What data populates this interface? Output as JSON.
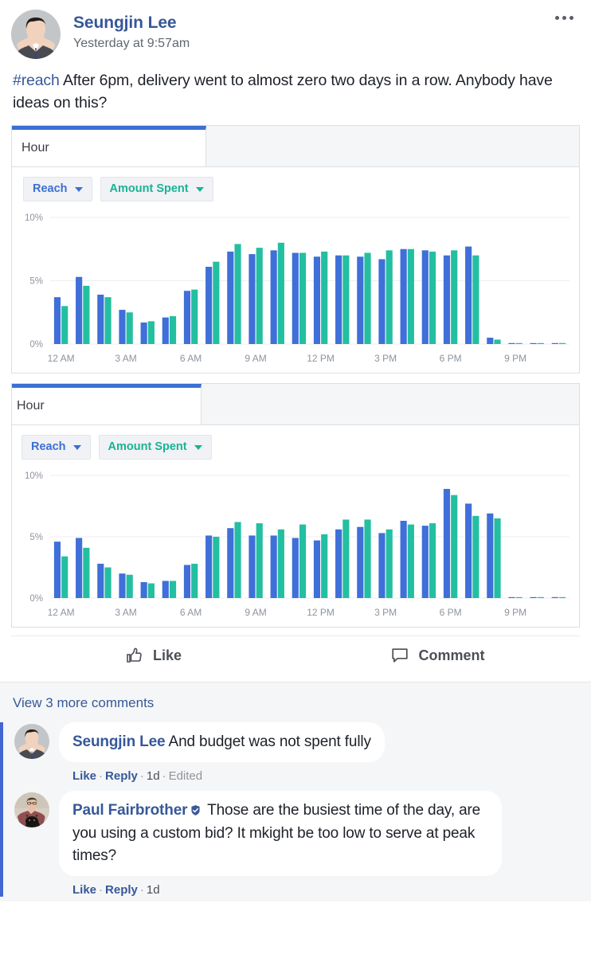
{
  "post": {
    "author": "Seungjin Lee",
    "timestamp": "Yesterday at 9:57am",
    "hashtag": "#reach",
    "body": "After 6pm, delivery went to almost zero two days in a row. Anybody have ideas on this?",
    "more_menu_icon": "ellipsis-icon"
  },
  "charts": [
    {
      "tab_label": "Hour",
      "metric_primary": "Reach",
      "metric_secondary": "Amount Spent"
    },
    {
      "tab_label": "Hour",
      "metric_primary": "Reach",
      "metric_secondary": "Amount Spent"
    }
  ],
  "actions": {
    "like_label": "Like",
    "like_icon": "thumbs-up-icon",
    "comment_label": "Comment",
    "comment_icon": "speech-bubble-icon"
  },
  "comments_section": {
    "view_more_label": "View 3 more comments",
    "comments": [
      {
        "author": "Seungjin Lee",
        "text": "And budget was not spent fully",
        "verified": false,
        "like_label": "Like",
        "reply_label": "Reply",
        "age": "1d",
        "edited_label": "Edited"
      },
      {
        "author": "Paul Fairbrother",
        "text": "Those are the busiest time of the day, are you using a custom bid? It mkight be too low to serve at peak times?",
        "verified": true,
        "badge_icon": "shield-badge-icon",
        "like_label": "Like",
        "reply_label": "Reply",
        "age": "1d",
        "edited_label": ""
      }
    ]
  },
  "colors": {
    "reach_blue": "#3f6fd8",
    "spent_teal": "#23bfa0",
    "link_blue": "#365899",
    "accent_rail": "#4267d4"
  },
  "chart_data": [
    {
      "type": "bar",
      "title": "",
      "xlabel": "Hour",
      "ylabel": "",
      "ylim": [
        0,
        10
      ],
      "ytick_labels": [
        "0%",
        "5%",
        "10%"
      ],
      "ytick_values": [
        0,
        5,
        10
      ],
      "grid": true,
      "legend_position": "top-left",
      "categories": [
        "12 AM",
        "1 AM",
        "2 AM",
        "3 AM",
        "4 AM",
        "5 AM",
        "6 AM",
        "7 AM",
        "8 AM",
        "9 AM",
        "10 AM",
        "11 AM",
        "12 PM",
        "1 PM",
        "2 PM",
        "3 PM",
        "4 PM",
        "5 PM",
        "6 PM",
        "7 PM",
        "8 PM",
        "9 PM",
        "10 PM",
        "11 PM"
      ],
      "xtick_labels": [
        "12 AM",
        "3 AM",
        "6 AM",
        "9 AM",
        "12 PM",
        "3 PM",
        "6 PM",
        "9 PM"
      ],
      "series": [
        {
          "name": "Reach",
          "color": "#3f6fd8",
          "values": [
            3.7,
            5.3,
            3.9,
            2.7,
            1.7,
            2.1,
            4.2,
            6.1,
            7.3,
            7.1,
            7.4,
            7.2,
            6.9,
            7.0,
            6.9,
            6.7,
            7.5,
            7.4,
            7.0,
            7.7,
            0.5,
            0.05,
            0.05,
            0.05
          ]
        },
        {
          "name": "Amount Spent",
          "color": "#23bfa0",
          "values": [
            3.0,
            4.6,
            3.7,
            2.5,
            1.8,
            2.2,
            4.3,
            6.5,
            7.9,
            7.6,
            8.0,
            7.2,
            7.3,
            7.0,
            7.2,
            7.4,
            7.5,
            7.3,
            7.4,
            7.0,
            0.35,
            0.05,
            0.05,
            0.05
          ]
        }
      ]
    },
    {
      "type": "bar",
      "title": "",
      "xlabel": "Hour",
      "ylabel": "",
      "ylim": [
        0,
        10
      ],
      "ytick_labels": [
        "0%",
        "5%",
        "10%"
      ],
      "ytick_values": [
        0,
        5,
        10
      ],
      "grid": true,
      "legend_position": "top-left",
      "categories": [
        "12 AM",
        "1 AM",
        "2 AM",
        "3 AM",
        "4 AM",
        "5 AM",
        "6 AM",
        "7 AM",
        "8 AM",
        "9 AM",
        "10 AM",
        "11 AM",
        "12 PM",
        "1 PM",
        "2 PM",
        "3 PM",
        "4 PM",
        "5 PM",
        "6 PM",
        "7 PM",
        "8 PM",
        "9 PM",
        "10 PM",
        "11 PM"
      ],
      "xtick_labels": [
        "12 AM",
        "3 AM",
        "6 AM",
        "9 AM",
        "12 PM",
        "3 PM",
        "6 PM",
        "9 PM"
      ],
      "series": [
        {
          "name": "Reach",
          "color": "#3f6fd8",
          "values": [
            4.6,
            4.9,
            2.8,
            2.0,
            1.3,
            1.4,
            2.7,
            5.1,
            5.7,
            5.1,
            5.1,
            4.9,
            4.7,
            5.6,
            5.8,
            5.3,
            6.3,
            5.9,
            8.9,
            7.7,
            6.9,
            0.05,
            0.05,
            0.05
          ]
        },
        {
          "name": "Amount Spent",
          "color": "#23bfa0",
          "values": [
            3.4,
            4.1,
            2.5,
            1.9,
            1.2,
            1.4,
            2.8,
            5.0,
            6.2,
            6.1,
            5.6,
            6.0,
            5.2,
            6.4,
            6.4,
            5.6,
            6.0,
            6.1,
            8.4,
            6.7,
            6.5,
            0.05,
            0.05,
            0.05
          ]
        }
      ]
    }
  ]
}
